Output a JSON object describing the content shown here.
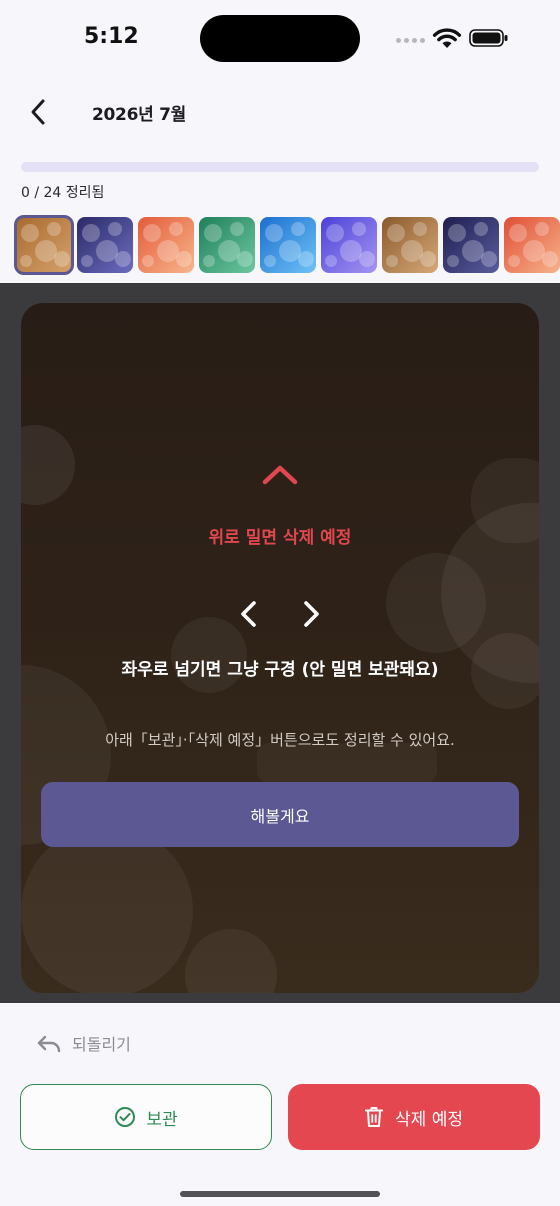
{
  "status_bar": {
    "time": "5:12"
  },
  "header": {
    "title": "2026년 7월"
  },
  "progress": {
    "done": 0,
    "total": 24,
    "fraction": 0,
    "label": "0 / 24 정리됨"
  },
  "thumbnails": [
    {
      "name": "thumb-1",
      "c1": "#a9692e",
      "c2": "#d4a26b",
      "selected": true
    },
    {
      "name": "thumb-2",
      "c1": "#2a2a66",
      "c2": "#6c6cc0",
      "selected": false
    },
    {
      "name": "thumb-3",
      "c1": "#e35b3a",
      "c2": "#f7b68b",
      "selected": false
    },
    {
      "name": "thumb-4",
      "c1": "#1f7f5a",
      "c2": "#6cc79f",
      "selected": false
    },
    {
      "name": "thumb-5",
      "c1": "#1a6fd0",
      "c2": "#6fc2f5",
      "selected": false
    },
    {
      "name": "thumb-6",
      "c1": "#4c42d8",
      "c2": "#a494f2",
      "selected": false
    },
    {
      "name": "thumb-7",
      "c1": "#8a5a2b",
      "c2": "#d6a878",
      "selected": false
    },
    {
      "name": "thumb-8",
      "c1": "#1e1f4f",
      "c2": "#5a5c9e",
      "selected": false
    },
    {
      "name": "thumb-9",
      "c1": "#e04e36",
      "c2": "#f7b28a",
      "selected": false
    }
  ],
  "card": {
    "up_label": "위로 밀면 삭제 예정",
    "lr_label": "좌우로 넘기면 그냥 구경 (안 밀면 보관돼요)",
    "hint": "아래「보관」·「삭제 예정」버튼으로도 정리할 수 있어요.",
    "try_button": "해볼게요"
  },
  "actions": {
    "undo": "되돌리기",
    "keep": "보관",
    "delete": "삭제 예정"
  },
  "colors": {
    "accent": "#5b5894",
    "danger": "#e4474f",
    "keep": "#2f8a55"
  },
  "icons": {
    "back": "chevron-left-icon",
    "up": "chevron-up-icon",
    "left": "chevron-left-icon",
    "right": "chevron-right-icon",
    "undo": "undo-icon",
    "keep": "check-circle-icon",
    "delete": "trash-icon"
  }
}
